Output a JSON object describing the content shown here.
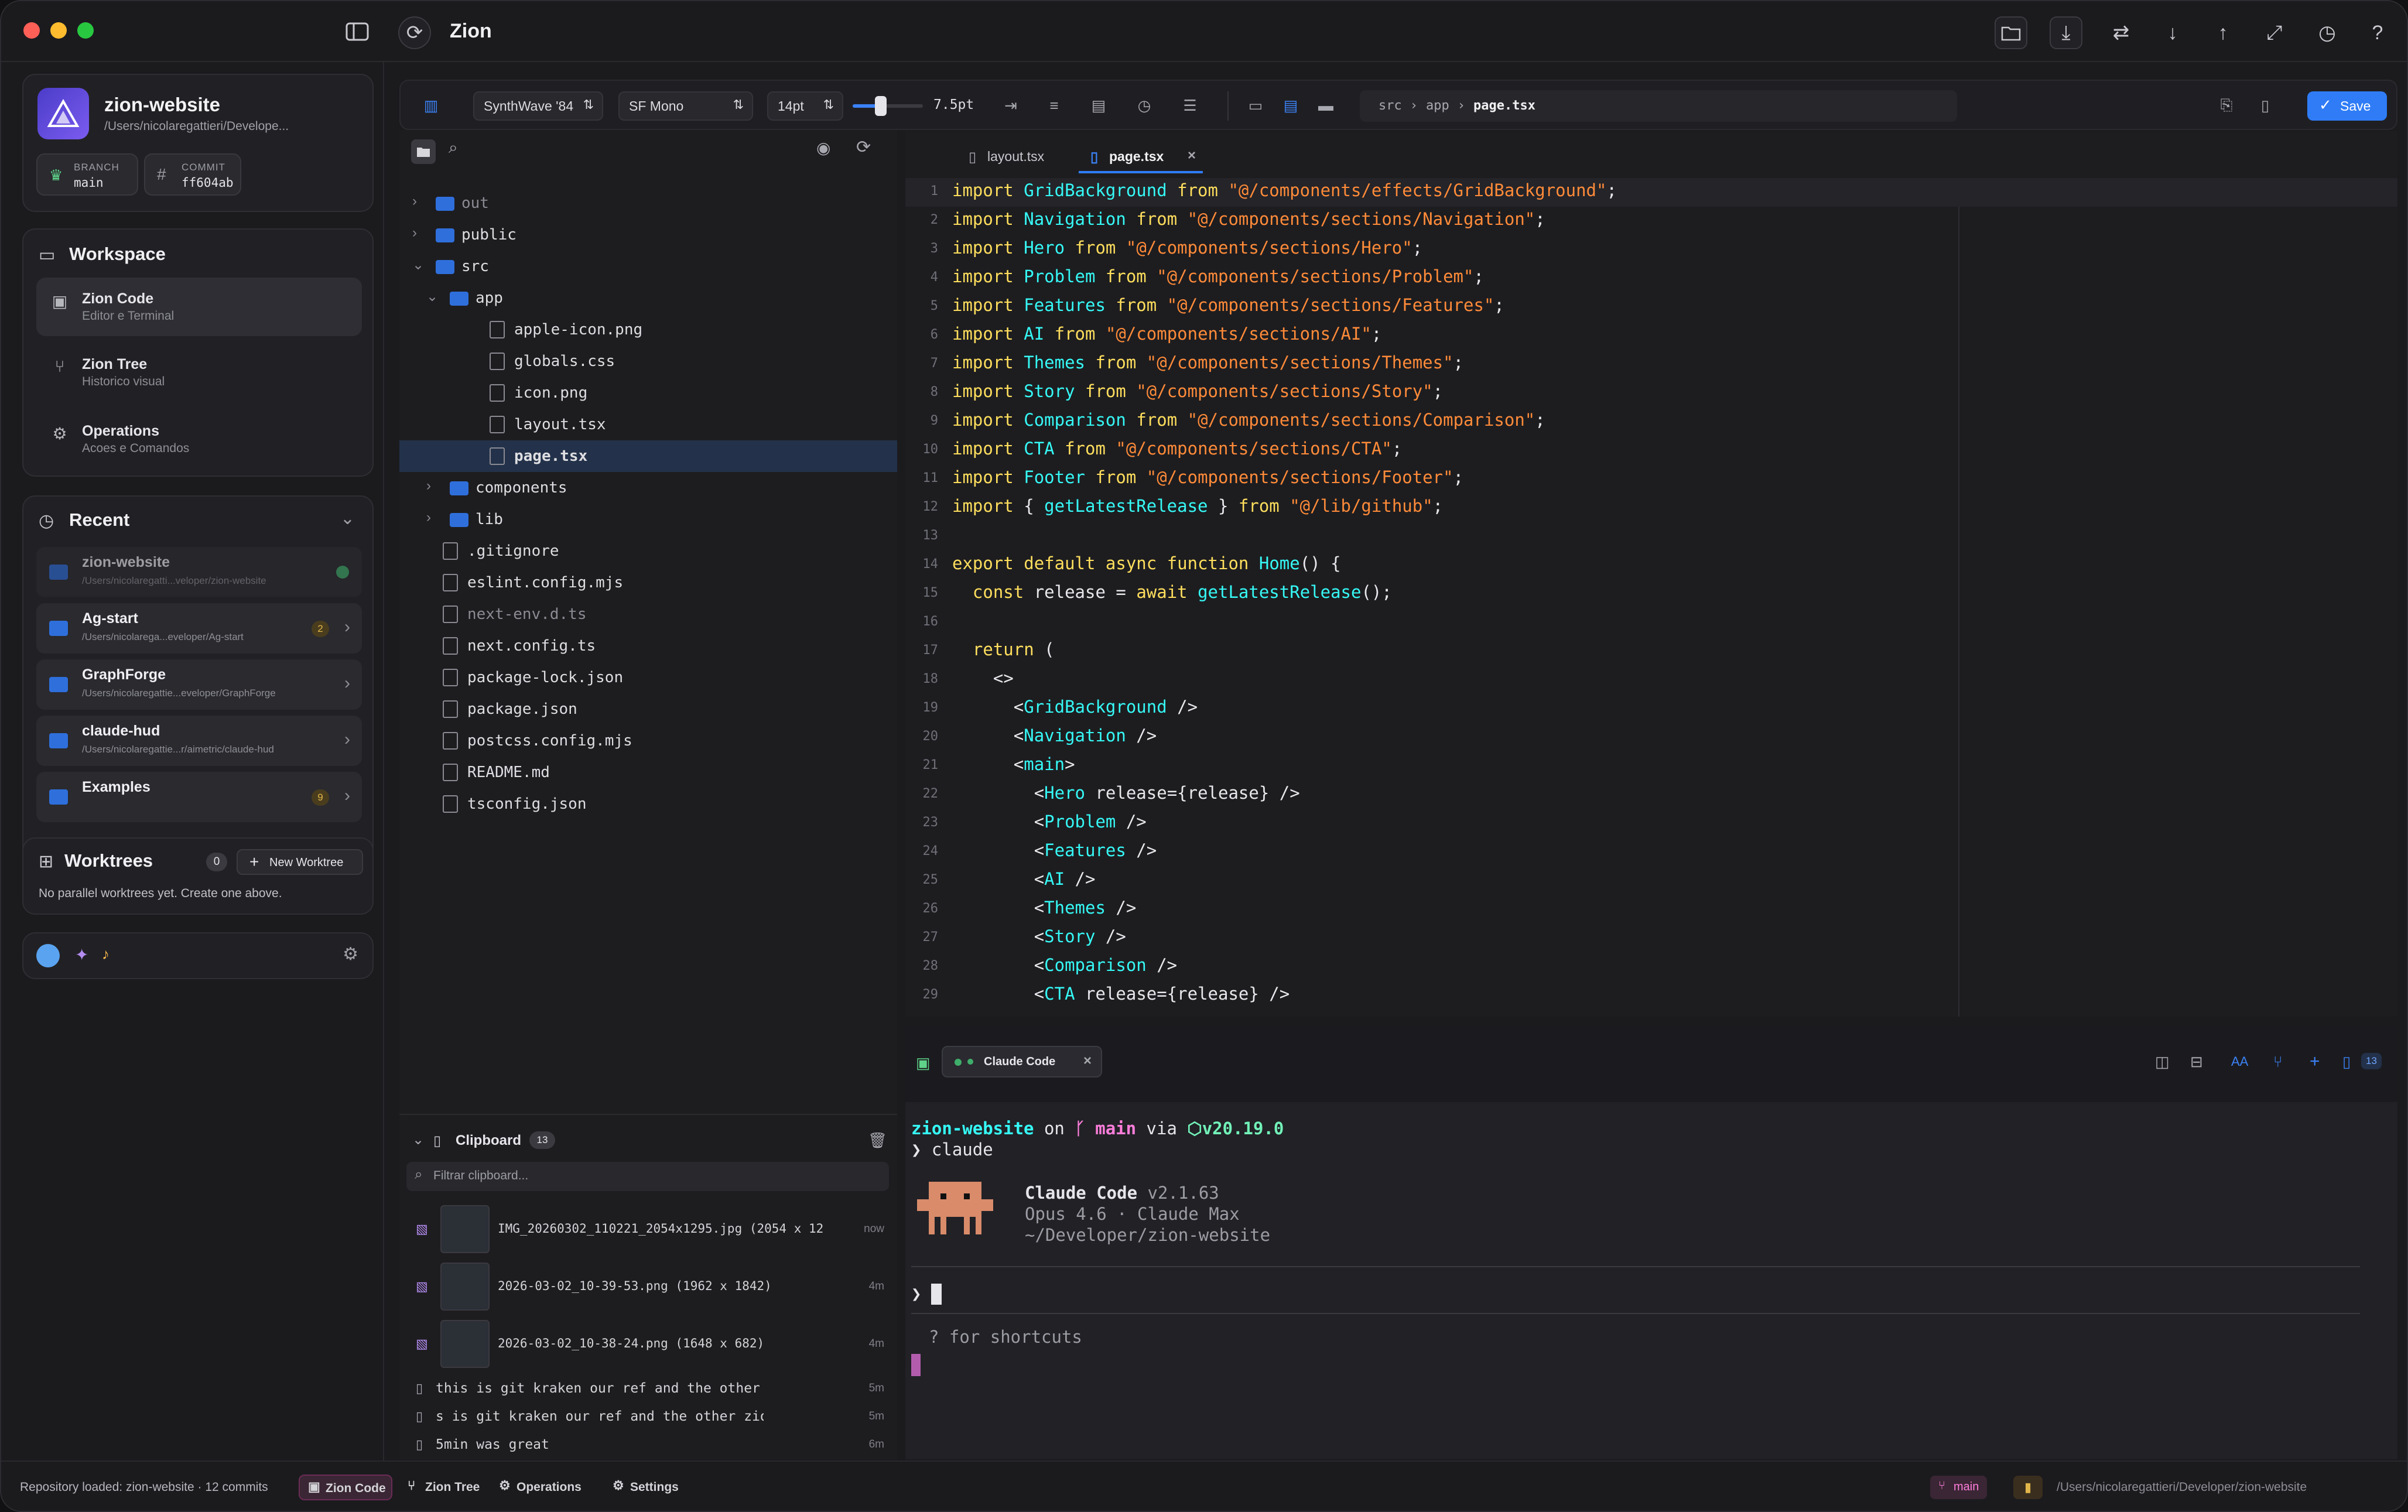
{
  "app": {
    "title": "Zion"
  },
  "repo": {
    "name": "zion-website",
    "path": "/Users/nicolaregattieri/Develope...",
    "branch_key": "BRANCH",
    "branch": "main",
    "commit_key": "COMMIT",
    "commit": "ff604ab"
  },
  "workspace": {
    "title": "Workspace",
    "items": [
      {
        "title": "Zion Code",
        "sub": "Editor e Terminal"
      },
      {
        "title": "Zion Tree",
        "sub": "Historico visual"
      },
      {
        "title": "Operations",
        "sub": "Acoes e Comandos"
      }
    ]
  },
  "recent": {
    "title": "Recent",
    "items": [
      {
        "name": "zion-website",
        "path": "/Users/nicolaregatti...veloper/zion-website",
        "badge": ""
      },
      {
        "name": "Ag-start",
        "path": "/Users/nicolarega...eveloper/Ag-start",
        "badge": "2"
      },
      {
        "name": "GraphForge",
        "path": "/Users/nicolaregattie...eveloper/GraphForge",
        "badge": ""
      },
      {
        "name": "claude-hud",
        "path": "/Users/nicolaregattie...r/aimetric/claude-hud",
        "badge": ""
      },
      {
        "name": "Examples",
        "path": "",
        "badge": "9"
      }
    ]
  },
  "worktrees": {
    "title": "Worktrees",
    "count": "0",
    "new_label": "New Worktree",
    "empty": "No parallel worktrees yet. Create one above."
  },
  "toolbar": {
    "theme": "SynthWave '84",
    "font": "SF Mono",
    "size": "14pt",
    "line_height": "7.5pt",
    "breadcrumb": [
      "src",
      "app",
      "page.tsx"
    ],
    "save": "Save"
  },
  "explorer": {
    "rows": [
      {
        "name": "out",
        "type": "folder",
        "depth": 0,
        "chev": "›",
        "dim": true
      },
      {
        "name": "public",
        "type": "folder",
        "depth": 0,
        "chev": "›"
      },
      {
        "name": "src",
        "type": "folder",
        "depth": 0,
        "chev": "⌄"
      },
      {
        "name": "app",
        "type": "folder",
        "depth": 1,
        "chev": "⌄"
      },
      {
        "name": "apple-icon.png",
        "type": "file",
        "depth": 2
      },
      {
        "name": "globals.css",
        "type": "file",
        "depth": 2
      },
      {
        "name": "icon.png",
        "type": "file",
        "depth": 2
      },
      {
        "name": "layout.tsx",
        "type": "file",
        "depth": 2
      },
      {
        "name": "page.tsx",
        "type": "file",
        "depth": 2,
        "selected": true
      },
      {
        "name": "components",
        "type": "folder",
        "depth": 1,
        "chev": "›"
      },
      {
        "name": "lib",
        "type": "folder",
        "depth": 1,
        "chev": "›"
      },
      {
        "name": ".gitignore",
        "type": "file",
        "depth": 0
      },
      {
        "name": "eslint.config.mjs",
        "type": "file",
        "depth": 0
      },
      {
        "name": "next-env.d.ts",
        "type": "file",
        "depth": 0,
        "dim": true
      },
      {
        "name": "next.config.ts",
        "type": "file",
        "depth": 0
      },
      {
        "name": "package-lock.json",
        "type": "file",
        "depth": 0
      },
      {
        "name": "package.json",
        "type": "file",
        "depth": 0
      },
      {
        "name": "postcss.config.mjs",
        "type": "file",
        "depth": 0
      },
      {
        "name": "README.md",
        "type": "file",
        "depth": 0
      },
      {
        "name": "tsconfig.json",
        "type": "file",
        "depth": 0
      }
    ]
  },
  "tabs": [
    {
      "label": "layout.tsx"
    },
    {
      "label": "page.tsx"
    }
  ],
  "code": [
    "import GridBackground from \"@/components/effects/GridBackground\";",
    "import Navigation from \"@/components/sections/Navigation\";",
    "import Hero from \"@/components/sections/Hero\";",
    "import Problem from \"@/components/sections/Problem\";",
    "import Features from \"@/components/sections/Features\";",
    "import AI from \"@/components/sections/AI\";",
    "import Themes from \"@/components/sections/Themes\";",
    "import Story from \"@/components/sections/Story\";",
    "import Comparison from \"@/components/sections/Comparison\";",
    "import CTA from \"@/components/sections/CTA\";",
    "import Footer from \"@/components/sections/Footer\";",
    "import { getLatestRelease } from \"@/lib/github\";",
    "",
    "export default async function Home() {",
    "  const release = await getLatestRelease();",
    "",
    "  return (",
    "    <>",
    "      <GridBackground />",
    "      <Navigation />",
    "      <main>",
    "        <Hero release={release} />",
    "        <Problem />",
    "        <Features />",
    "        <AI />",
    "        <Themes />",
    "        <Story />",
    "        <Comparison />",
    "        <CTA release={release} />"
  ],
  "terminal": {
    "tab": "Claude Code",
    "count": "13",
    "prompt_dir": "zion-website",
    "on": " on ",
    "branch": "main",
    "via": " via ",
    "node": "v20.19.0",
    "cmd": "claude",
    "cc_name": "Claude Code",
    "cc_version": "v2.1.63",
    "cc_model": "Opus 4.6 · Claude Max",
    "cc_dir": "~/Developer/zion-website",
    "hint": "? for shortcuts"
  },
  "clipboard": {
    "title": "Clipboard",
    "count": "13",
    "filter_placeholder": "Filtrar clipboard...",
    "items": [
      {
        "text": "IMG_20260302_110221_2054x1295.jpg (2054 x 12...",
        "time": "now",
        "img": true
      },
      {
        "text": "2026-03-02_10-39-53.png (1962 x 1842)",
        "time": "4m",
        "img": true
      },
      {
        "text": "2026-03-02_10-38-24.png (1648 x 682)",
        "time": "4m",
        "img": true
      },
      {
        "text": "this is git kraken our ref and the other zion....",
        "time": "5m",
        "img": false
      },
      {
        "text": "s is git kraken our ref and the other zion... lo...",
        "time": "5m",
        "img": false
      },
      {
        "text": "5min was great",
        "time": "6m",
        "img": false
      }
    ]
  },
  "statusbar": {
    "message": "Repository loaded: zion-website · 12 commits",
    "buttons": [
      "Zion Code",
      "Zion Tree",
      "Operations",
      "Settings"
    ],
    "branch": "main",
    "path": "/Users/nicolaregattieri/Developer/zion-website"
  },
  "colors": {
    "accent": "#2f7cf6",
    "folder": "#2f6fdc",
    "keyword": "#fede5d",
    "string": "#ff8b39",
    "ident": "#72f1b8"
  }
}
